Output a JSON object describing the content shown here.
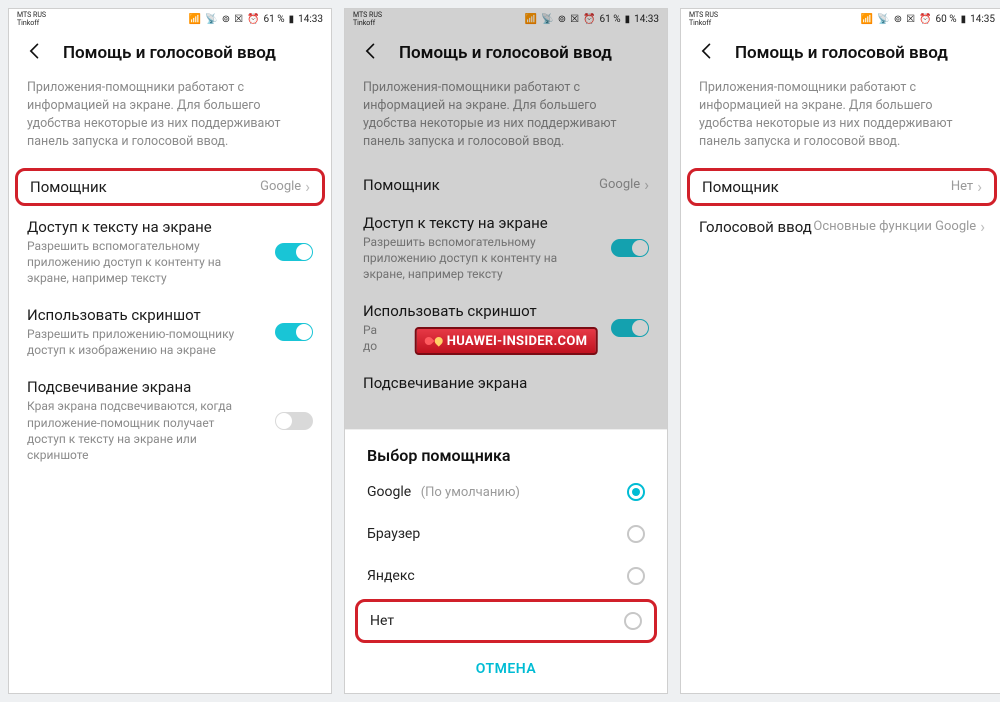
{
  "status": {
    "operator1": "MTS RUS",
    "operator2": "Tinkoff",
    "battery1": "61 %",
    "time1": "14:33",
    "battery3": "60 %",
    "time3": "14:35"
  },
  "header": {
    "title": "Помощь и голосовой ввод"
  },
  "description": "Приложения-помощники работают с информацией на экране. Для большего удобства некоторые из них поддерживают панель запуска и голосовой ввод.",
  "rows": {
    "assistant": {
      "label": "Помощник",
      "value1": "Google",
      "value3": "Нет"
    },
    "voice_input": {
      "label": "Голосовой ввод",
      "value": "Основные функции Google"
    },
    "text_access": {
      "label": "Доступ к тексту на экране",
      "sub": "Разрешить вспомогательному приложению доступ к контенту на экране, например тексту"
    },
    "screenshot": {
      "label": "Использовать скриншот",
      "sub_full": "Разрешить приложению-помощнику доступ к изображению на экране",
      "sub_cut1": "Ра",
      "sub_cut2": "до"
    },
    "flash": {
      "label": "Подсвечивание экрана",
      "sub": "Края экрана подсвечиваются, когда приложение-помощник получает доступ к тексту на экране или скриншоте"
    }
  },
  "sheet": {
    "title": "Выбор помощника",
    "options": {
      "google": "Google",
      "google_default": "(По умолчанию)",
      "browser": "Браузер",
      "yandex": "Яндекс",
      "none": "Нет"
    },
    "cancel": "ОТМЕНА"
  },
  "watermark": "HUAWEI-INSIDER.COM"
}
